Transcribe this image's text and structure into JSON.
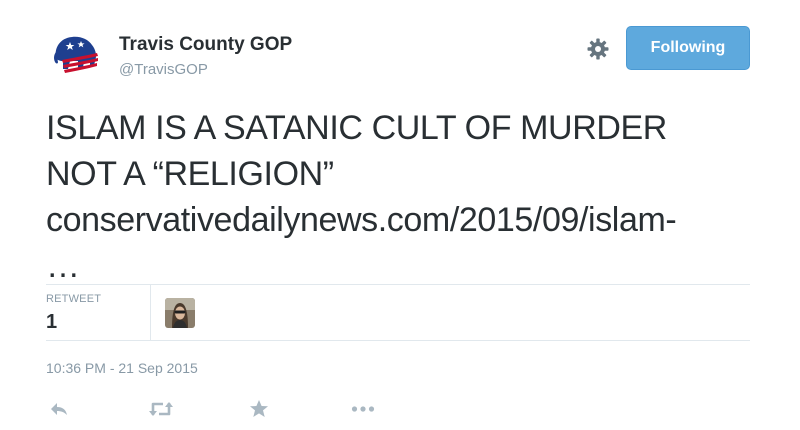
{
  "header": {
    "display_name": "Travis County GOP",
    "handle": "@TravisGOP",
    "avatar_icon": "elephant-flag-logo",
    "settings_icon": "gear-icon",
    "follow_button_label": "Following"
  },
  "tweet": {
    "text_line_1": "ISLAM IS A SATANIC CULT OF MURDER",
    "text_line_2": "NOT A “RELIGION”",
    "link_text": "conservativedailynews.com/2015/09/islam-",
    "link_ellipsis": "…"
  },
  "stats": {
    "retweet_label": "RETWEET",
    "retweet_count": "1",
    "retweeter_avatar": "user-avatar"
  },
  "timestamp": "10:36 PM - 21 Sep 2015",
  "actions": [
    {
      "name": "reply",
      "icon": "reply-icon"
    },
    {
      "name": "retweet",
      "icon": "retweet-icon"
    },
    {
      "name": "favorite",
      "icon": "star-icon"
    },
    {
      "name": "more",
      "icon": "more-icon"
    }
  ],
  "colors": {
    "follow_button": "#5ea9dd",
    "text": "#292f33",
    "muted": "#8899a6",
    "action_icon": "#aab8c2",
    "divider": "#e1e8ed",
    "logo_blue": "#1e3f8f",
    "logo_red": "#c8102e"
  }
}
